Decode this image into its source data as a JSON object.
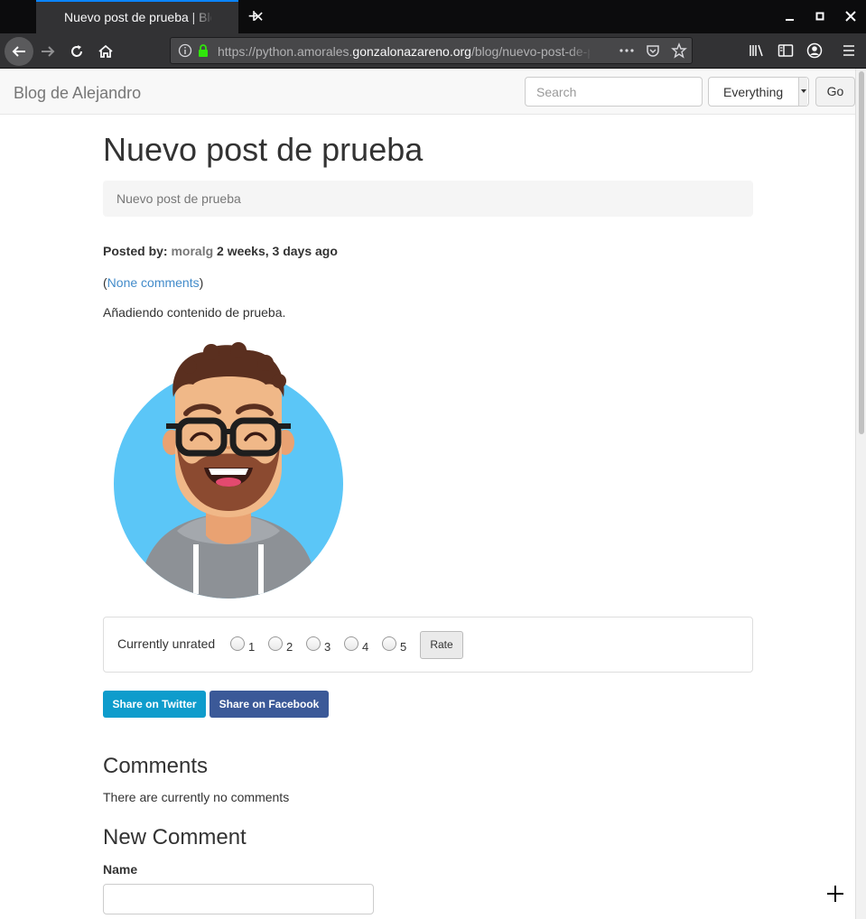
{
  "browser": {
    "tab_title": "Nuevo post de prueba | Blog de Alejandro",
    "url_prefix": "https://python.amorales.",
    "url_domain": "gonzalonazareno.org",
    "url_path": "/blog/nuevo-post-de-prueba/"
  },
  "site": {
    "brand": "Blog de Alejandro",
    "search_placeholder": "Search",
    "search_scope": "Everything",
    "go_label": "Go"
  },
  "post": {
    "title": "Nuevo post de prueba",
    "lead": "Nuevo post de prueba",
    "posted_by_label": "Posted by:",
    "author": "moralg",
    "time_ago": "2 weeks, 3 days ago",
    "comments_paren_open": "(",
    "comments_link": "None comments",
    "comments_paren_close": ")",
    "body": "Añadiendo contenido de prueba."
  },
  "rating": {
    "label": "Currently unrated",
    "options": [
      "1",
      "2",
      "3",
      "4",
      "5"
    ],
    "button": "Rate"
  },
  "share": {
    "twitter": "Share on Twitter",
    "facebook": "Share on Facebook"
  },
  "comments": {
    "heading": "Comments",
    "empty_text": "There are currently no comments",
    "new_heading": "New Comment",
    "name_label": "Name"
  },
  "colors": {
    "twitter": "#0e9ccc",
    "facebook": "#3b5998",
    "link": "#428bca",
    "avatar_bg": "#5bc6f7"
  }
}
